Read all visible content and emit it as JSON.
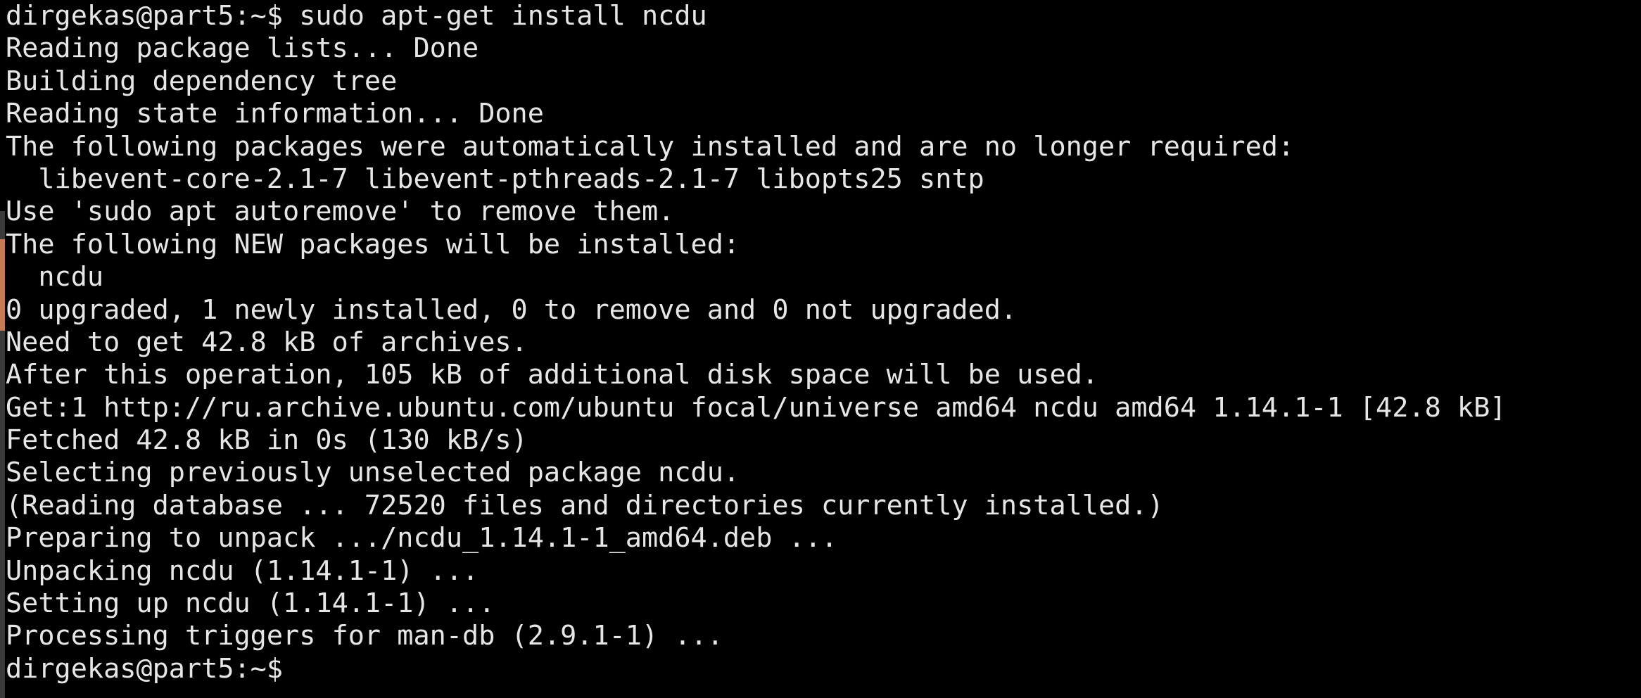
{
  "terminal": {
    "prompt": "dirgekas@part5:~$",
    "lines": [
      "dirgekas@part5:~$ sudo apt-get install ncdu",
      "Reading package lists... Done",
      "Building dependency tree",
      "Reading state information... Done",
      "The following packages were automatically installed and are no longer required:",
      "  libevent-core-2.1-7 libevent-pthreads-2.1-7 libopts25 sntp",
      "Use 'sudo apt autoremove' to remove them.",
      "The following NEW packages will be installed:",
      "  ncdu",
      "0 upgraded, 1 newly installed, 0 to remove and 0 not upgraded.",
      "Need to get 42.8 kB of archives.",
      "After this operation, 105 kB of additional disk space will be used.",
      "Get:1 http://ru.archive.ubuntu.com/ubuntu focal/universe amd64 ncdu amd64 1.14.1-1 [42.8 kB]",
      "Fetched 42.8 kB in 0s (130 kB/s)",
      "Selecting previously unselected package ncdu.",
      "(Reading database ... 72520 files and directories currently installed.)",
      "Preparing to unpack .../ncdu_1.14.1-1_amd64.deb ...",
      "Unpacking ncdu (1.14.1-1) ...",
      "Setting up ncdu (1.14.1-1) ...",
      "Processing triggers for man-db (2.9.1-1) ...",
      "dirgekas@part5:~$"
    ]
  },
  "colors": {
    "background": "#000000",
    "foreground": "#e6e6e6"
  }
}
